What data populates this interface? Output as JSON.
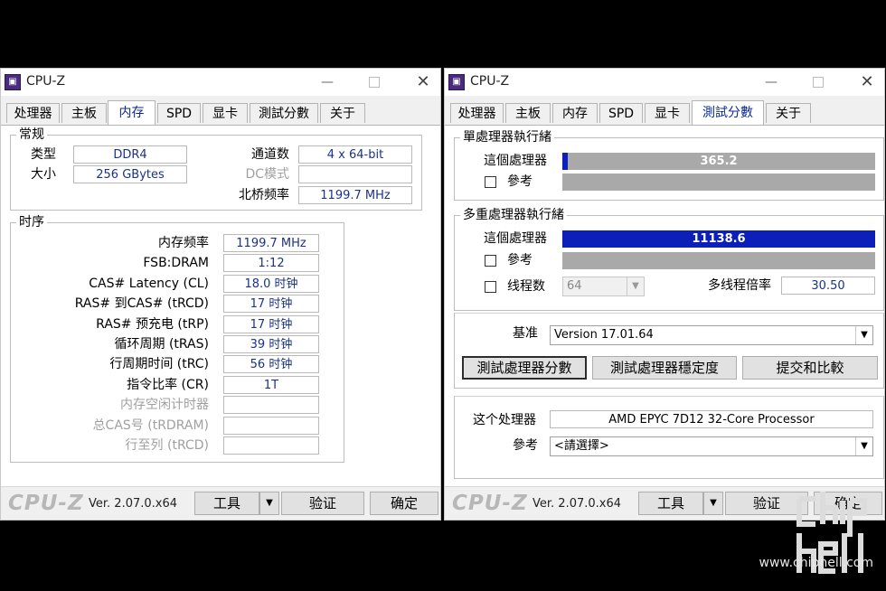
{
  "app_title": "CPU-Z",
  "window_controls": {
    "minimize": "—",
    "close": "✕"
  },
  "tabs": [
    "处理器",
    "主板",
    "内存",
    "SPD",
    "显卡",
    "測試分數",
    "关于"
  ],
  "left": {
    "active_tab": "内存",
    "general": {
      "title": "常规",
      "type_label": "类型",
      "type_value": "DDR4",
      "size_label": "大小",
      "size_value": "256 GBytes",
      "channels_label": "通道数",
      "channels_value": "4 x 64-bit",
      "dc_mode_label": "DC模式",
      "dc_mode_value": "",
      "nb_freq_label": "北桥频率",
      "nb_freq_value": "1199.7 MHz"
    },
    "timings": {
      "title": "时序",
      "rows": [
        {
          "label": "内存频率",
          "value": "1199.7 MHz",
          "disabled": false
        },
        {
          "label": "FSB:DRAM",
          "value": "1:12",
          "disabled": false
        },
        {
          "label": "CAS# Latency (CL)",
          "value": "18.0 时钟",
          "disabled": false
        },
        {
          "label": "RAS# 到CAS# (tRCD)",
          "value": "17 时钟",
          "disabled": false
        },
        {
          "label": "RAS# 预充电 (tRP)",
          "value": "17 时钟",
          "disabled": false
        },
        {
          "label": "循环周期 (tRAS)",
          "value": "39 时钟",
          "disabled": false
        },
        {
          "label": "行周期时间 (tRC)",
          "value": "56 时钟",
          "disabled": false
        },
        {
          "label": "指令比率 (CR)",
          "value": "1T",
          "disabled": false
        },
        {
          "label": "内存空闲计时器",
          "value": "",
          "disabled": true
        },
        {
          "label": "总CAS号 (tRDRAM)",
          "value": "",
          "disabled": true
        },
        {
          "label": "行至列 (tRCD)",
          "value": "",
          "disabled": true
        }
      ]
    }
  },
  "right": {
    "active_tab": "測試分數",
    "single": {
      "title": "單處理器執行緒",
      "this_label": "這個處理器",
      "this_value": "365.2",
      "this_fraction": 0.018,
      "ref_label": "參考"
    },
    "multi": {
      "title": "多重處理器執行緒",
      "this_label": "這個處理器",
      "this_value": "11138.6",
      "this_fraction": 1.0,
      "ref_label": "參考",
      "threads_label": "线程数",
      "threads_value": "64",
      "ratio_label": "多线程倍率",
      "ratio_value": "30.50"
    },
    "baseline_label": "基准",
    "baseline_value": "Version 17.01.64",
    "buttons": {
      "bench": "測試處理器分數",
      "stress": "測試處理器穩定度",
      "submit": "提交和比較"
    },
    "this_cpu_label": "这个处理器",
    "this_cpu_value": "AMD EPYC 7D12 32-Core Processor",
    "ref_label": "參考",
    "ref_value": "<請選擇>"
  },
  "footer": {
    "logo": "CPU-Z",
    "version": "Ver. 2.07.0.x64",
    "tools": "工具",
    "validate": "验证",
    "ok": "确定"
  },
  "watermark": "www.chiphell.com",
  "colors": {
    "bar_fill": "#0c1fb8",
    "bar_bg": "#a9a9a9",
    "value_text": "#1a3288",
    "background": "#000000"
  }
}
